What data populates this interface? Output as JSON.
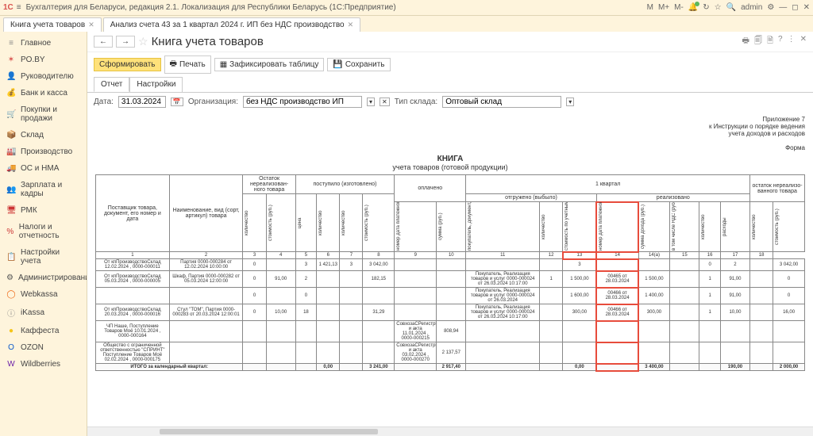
{
  "titlebar": {
    "logo": "1С",
    "title": "Бухгалтерия для Беларуси, редакция 2.1. Локализация для Республики Беларусь  (1С:Предприятие)",
    "user": "admin",
    "m": "M",
    "mp": "M+",
    "mm": "M-"
  },
  "tabs": [
    {
      "label": "Книга учета товаров",
      "active": true
    },
    {
      "label": "Анализ счета 43 за 1 квартал 2024 г. ИП без НДС производство",
      "active": false
    }
  ],
  "sidebar": [
    {
      "ico": "≡",
      "color": "#888",
      "label": "Главное"
    },
    {
      "ico": "✶",
      "color": "#d9534f",
      "label": "PO.BY"
    },
    {
      "ico": "👤",
      "color": "#d27b2c",
      "label": "Руководителю"
    },
    {
      "ico": "💰",
      "color": "#e6b800",
      "label": "Банк и касса"
    },
    {
      "ico": "🛒",
      "color": "#b56b2c",
      "label": "Покупки и продажи"
    },
    {
      "ico": "📦",
      "color": "#8b5a2b",
      "label": "Склад"
    },
    {
      "ico": "🏭",
      "color": "#555",
      "label": "Производство"
    },
    {
      "ico": "🚚",
      "color": "#555",
      "label": "ОС и НМА"
    },
    {
      "ico": "👥",
      "color": "#4a8",
      "label": "Зарплата и кадры"
    },
    {
      "ico": "🖥",
      "color": "#c33",
      "label": "РМК"
    },
    {
      "ico": "%",
      "color": "#c33",
      "label": "Налоги и отчетность"
    },
    {
      "ico": "📋",
      "color": "#555",
      "label": "Настройки учета"
    },
    {
      "ico": "⚙",
      "color": "#555",
      "label": "Администрирование"
    },
    {
      "ico": "◯",
      "color": "#e61",
      "label": "Webkassa"
    },
    {
      "ico": "ⓘ",
      "color": "#888",
      "label": "iKassa"
    },
    {
      "ico": "●",
      "color": "#f5c518",
      "label": "Каффеста"
    },
    {
      "ico": "O",
      "color": "#0a58ca",
      "label": "OZON"
    },
    {
      "ico": "W",
      "color": "#6b21a8",
      "label": "Wildberries"
    }
  ],
  "page": {
    "title": "Книга учета товаров",
    "btn_form": "Сформировать",
    "btn_print": "Печать",
    "btn_fix": "Зафиксировать таблицу",
    "btn_save": "Сохранить",
    "tab_report": "Отчет",
    "tab_settings": "Настройки",
    "lbl_date": "Дата:",
    "date": "31.03.2024",
    "lbl_org": "Организация:",
    "org": "без НДС производство ИП",
    "lbl_wtype": "Тип склада:",
    "wtype": "Оптовый склад",
    "annex1": "Приложение 7",
    "annex2": "к Инструкции о порядке ведения",
    "annex3": "учета доходов и расходов",
    "annex4": "Форма",
    "rtitle": "КНИГА",
    "rsub": "учета товаров (готовой продукции)"
  },
  "head": {
    "supplier": "Поставщик товара, документ, его номер и дата",
    "name": "Наименование, вид (сорт, артикул) товара",
    "rest_begin": "Остаток нереализован-ного товара",
    "received": "поступило (изготовлено)",
    "paid": "оплачено",
    "q1": "1 квартал",
    "shipped": "отгружено (выбыло)",
    "realized": "реализовано",
    "rest_end": "остаток нереализо-ванного товара",
    "kvo": "количество",
    "cost": "стоимость (руб.)",
    "price": "цена",
    "doc": "номер дата платежной инструкции",
    "sum": "сумма (руб.)",
    "buyer": "покупатель, документ, его номер и дата",
    "cost_acq": "стоимость по учетным ценам (по цене приобретения) (руб.)",
    "doc2": "номер дата платежной инструкции",
    "income": "сумма дохода (руб.)",
    "vat": "в том числе НДС (руб.)",
    "expense": "расходы"
  },
  "colnums": [
    "1",
    "2",
    "3",
    "4",
    "5",
    "6",
    "7",
    "8",
    "9",
    "10",
    "11",
    "12",
    "13",
    "14",
    "14(а)",
    "15",
    "16",
    "17",
    "18"
  ],
  "rows": [
    {
      "c1": "От кпПроизводствоСклад 12.02.2024 , 0000-000011",
      "c2": "Партия 0000-000284 от 12.02.2024 10:00:00",
      "c3": "0",
      "c4": "",
      "c5": "3",
      "c6": "1 421,13",
      "c7": "3",
      "c8": "3 042,00",
      "c9": "",
      "c10": "",
      "c11": "",
      "c12": "",
      "c13": "3",
      "c14": "",
      "c15": "",
      "c16": "",
      "c17": "0",
      "c18": "2",
      "c19": "3 042,00"
    },
    {
      "c1": "От кпПроизводствоСклад 05.03.2024 , 0000-000005",
      "c2": "Шкаф, Партия 0000-000282 от 05.03.2024 12:00:00",
      "c3": "0",
      "c4": "91,00",
      "c5": "2",
      "c6": "",
      "c7": "",
      "c8": "182,15",
      "c9": "",
      "c10": "",
      "c11": "Покупатель, Реализация товаров и услуг 0000-000024 от 26.03.2024 10:17:00",
      "c12": "1",
      "c13": "1 500,00",
      "c14": "00465 от 28.03.2024",
      "c15": "1 500,00",
      "c16": "",
      "c17": "1",
      "c18": "91,00",
      "c19": "0"
    },
    {
      "c1": "",
      "c2": "",
      "c3": "0",
      "c4": "",
      "c5": "0",
      "c6": "",
      "c7": "",
      "c8": "",
      "c9": "",
      "c10": "",
      "c11": "Покупатель, Реализация товаров и услуг 0000-000024 от 26.03.2024",
      "c12": "",
      "c13": "1 600,00",
      "c14": "00466 от 28.03.2024",
      "c15": "1 400,00",
      "c16": "",
      "c17": "1",
      "c18": "91,00",
      "c19": "0"
    },
    {
      "c1": "От кпПроизводствоСклад 20.03.2024 , 0000-000016",
      "c2": "Стул \"ТОМ\", Партия 0000-000283 от 20.03.2024 12:00:01",
      "c3": "0",
      "c4": "10,00",
      "c5": "18",
      "c6": "",
      "c7": "",
      "c8": "31,29",
      "c9": "",
      "c10": "",
      "c11": "Покупатель, Реализация товаров и услуг 0000-000024 от 26.03.2024 10:17:00",
      "c12": "",
      "c13": "300,00",
      "c14": "00466 от 28.03.2024",
      "c15": "300,00",
      "c16": "",
      "c17": "1",
      "c18": "10,00",
      "c19": "16,00"
    },
    {
      "c1": "ЧП Наше, Поступление Товаров Моё 10.01.2024 , 0000-000164",
      "c2": "",
      "c3": "",
      "c4": "",
      "c5": "",
      "c6": "",
      "c7": "",
      "c8": "",
      "c9": "СовхозаСРегистрЦен и акта 11.01.2024 , 0000-000215",
      "c10": "808,94",
      "c11": "",
      "c12": "",
      "c13": "",
      "c14": "",
      "c15": "",
      "c16": "",
      "c17": "",
      "c18": "",
      "c19": ""
    },
    {
      "c1": "Общество с ограниченной ответственностью \"СПРИНТ\" Поступление Товаров Моё 02.02.2024 , 0000-000175",
      "c2": "",
      "c3": "",
      "c4": "",
      "c5": "",
      "c6": "",
      "c7": "",
      "c8": "",
      "c9": "СовхозаСРегистрЦен и акта 03.02.2024 , 0000-000270",
      "c10": "2 137,57",
      "c11": "",
      "c12": "",
      "c13": "",
      "c14": "",
      "c15": "",
      "c16": "",
      "c17": "",
      "c18": "",
      "c19": ""
    }
  ],
  "total": {
    "label": "ИТОГО за календарный квартал:",
    "c6": "0,00",
    "c8": "3 241,00",
    "c10": "2 917,40",
    "c13": "0,00",
    "c15": "3 400,00",
    "c18": "190,00",
    "c19": "2 000,00"
  }
}
